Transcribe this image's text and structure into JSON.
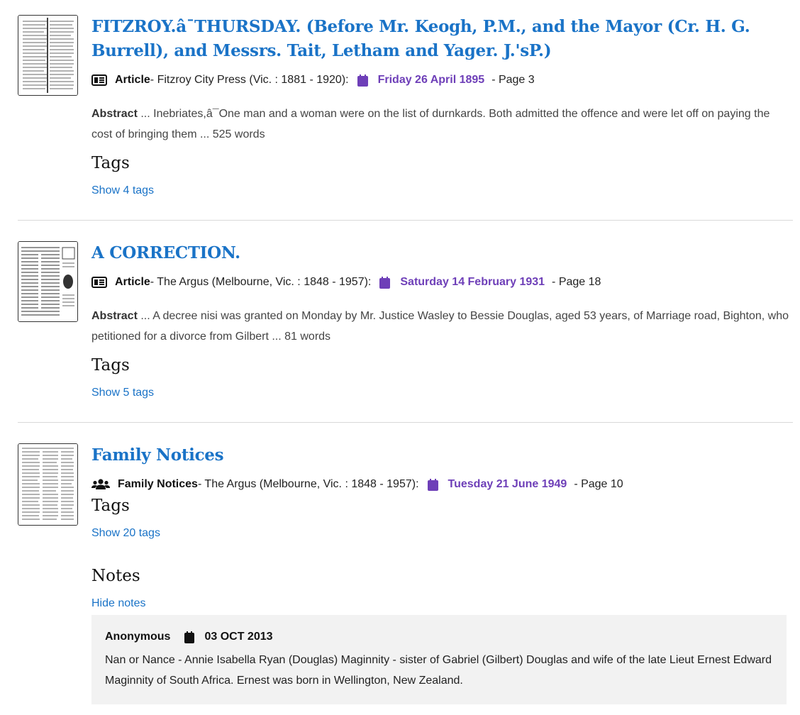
{
  "results": [
    {
      "title": "FITZROY.â¯THURSDAY. (Before Mr. Keogh, P.M., and the Mayor (Cr. H. G. Burrell), and Messrs. Tait, Letham and Yager. J.'sP.)",
      "type_icon": "newspaper-icon",
      "type": "Article",
      "source": "- Fitzroy City Press (Vic. : 1881 - 1920):",
      "date": "Friday 26 April 1895",
      "page": "- Page 3",
      "abstract_label": "Abstract",
      "abstract": " ... Inebriates,â¯One man and a woman were on the list of durnkards. Both admitted the offence and were let off on paying the cost of bringing them ... 525 words",
      "tags_heading": "Tags",
      "tags_link": "Show 4 tags"
    },
    {
      "title": "A CORRECTION.",
      "type_icon": "newspaper-icon",
      "type": "Article",
      "source": "- The Argus (Melbourne, Vic. : 1848 - 1957):",
      "date": "Saturday 14 February 1931",
      "page": "- Page 18",
      "abstract_label": "Abstract",
      "abstract": " ... A decree nisi was granted on Monday by Mr. Justice Wasley to Bessie Douglas, aged 53 years, of Marriage road, Bighton, who petitioned for a divorce from Gilbert ... 81 words",
      "tags_heading": "Tags",
      "tags_link": "Show 5 tags"
    },
    {
      "title": "Family Notices",
      "type_icon": "users-icon",
      "type": "Family Notices",
      "source": "- The Argus (Melbourne, Vic. : 1848 - 1957):",
      "date": "Tuesday 21 June 1949",
      "page": "- Page 10",
      "tags_heading": "Tags",
      "tags_link": "Show 20 tags",
      "notes_heading": "Notes",
      "notes_link": "Hide notes",
      "note": {
        "author": "Anonymous",
        "date": "03 OCT 2013",
        "text": "Nan or Nance - Annie Isabella Ryan (Douglas) Maginnity - sister of Gabriel (Gilbert) Douglas and wife of the late Lieut Ernest Edward Maginnity of South Africa. Ernest was born in Wellington, New Zealand."
      }
    }
  ],
  "colors": {
    "link": "#1a73c7",
    "date": "#6e3fb8",
    "calendar_icon": "#6e3fb8",
    "note_bg": "#f2f2f2"
  }
}
